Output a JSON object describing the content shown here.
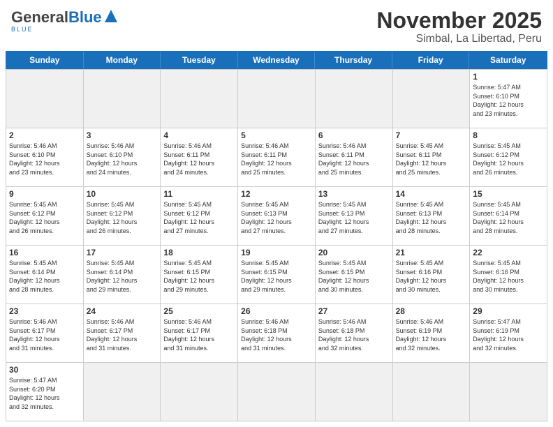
{
  "header": {
    "logo_general": "General",
    "logo_blue": "Blue",
    "month_title": "November 2025",
    "location": "Simbal, La Libertad, Peru"
  },
  "days": {
    "headers": [
      "Sunday",
      "Monday",
      "Tuesday",
      "Wednesday",
      "Thursday",
      "Friday",
      "Saturday"
    ]
  },
  "cells": [
    {
      "number": "",
      "info": "",
      "empty": true
    },
    {
      "number": "",
      "info": "",
      "empty": true
    },
    {
      "number": "",
      "info": "",
      "empty": true
    },
    {
      "number": "",
      "info": "",
      "empty": true
    },
    {
      "number": "",
      "info": "",
      "empty": true
    },
    {
      "number": "",
      "info": "",
      "empty": true
    },
    {
      "number": "1",
      "info": "Sunrise: 5:47 AM\nSunset: 6:10 PM\nDaylight: 12 hours\nand 23 minutes."
    },
    {
      "number": "2",
      "info": "Sunrise: 5:46 AM\nSunset: 6:10 PM\nDaylight: 12 hours\nand 23 minutes."
    },
    {
      "number": "3",
      "info": "Sunrise: 5:46 AM\nSunset: 6:10 PM\nDaylight: 12 hours\nand 24 minutes."
    },
    {
      "number": "4",
      "info": "Sunrise: 5:46 AM\nSunset: 6:11 PM\nDaylight: 12 hours\nand 24 minutes."
    },
    {
      "number": "5",
      "info": "Sunrise: 5:46 AM\nSunset: 6:11 PM\nDaylight: 12 hours\nand 25 minutes."
    },
    {
      "number": "6",
      "info": "Sunrise: 5:46 AM\nSunset: 6:11 PM\nDaylight: 12 hours\nand 25 minutes."
    },
    {
      "number": "7",
      "info": "Sunrise: 5:45 AM\nSunset: 6:11 PM\nDaylight: 12 hours\nand 25 minutes."
    },
    {
      "number": "8",
      "info": "Sunrise: 5:45 AM\nSunset: 6:12 PM\nDaylight: 12 hours\nand 26 minutes."
    },
    {
      "number": "9",
      "info": "Sunrise: 5:45 AM\nSunset: 6:12 PM\nDaylight: 12 hours\nand 26 minutes."
    },
    {
      "number": "10",
      "info": "Sunrise: 5:45 AM\nSunset: 6:12 PM\nDaylight: 12 hours\nand 26 minutes."
    },
    {
      "number": "11",
      "info": "Sunrise: 5:45 AM\nSunset: 6:12 PM\nDaylight: 12 hours\nand 27 minutes."
    },
    {
      "number": "12",
      "info": "Sunrise: 5:45 AM\nSunset: 6:13 PM\nDaylight: 12 hours\nand 27 minutes."
    },
    {
      "number": "13",
      "info": "Sunrise: 5:45 AM\nSunset: 6:13 PM\nDaylight: 12 hours\nand 27 minutes."
    },
    {
      "number": "14",
      "info": "Sunrise: 5:45 AM\nSunset: 6:13 PM\nDaylight: 12 hours\nand 28 minutes."
    },
    {
      "number": "15",
      "info": "Sunrise: 5:45 AM\nSunset: 6:14 PM\nDaylight: 12 hours\nand 28 minutes."
    },
    {
      "number": "16",
      "info": "Sunrise: 5:45 AM\nSunset: 6:14 PM\nDaylight: 12 hours\nand 28 minutes."
    },
    {
      "number": "17",
      "info": "Sunrise: 5:45 AM\nSunset: 6:14 PM\nDaylight: 12 hours\nand 29 minutes."
    },
    {
      "number": "18",
      "info": "Sunrise: 5:45 AM\nSunset: 6:15 PM\nDaylight: 12 hours\nand 29 minutes."
    },
    {
      "number": "19",
      "info": "Sunrise: 5:45 AM\nSunset: 6:15 PM\nDaylight: 12 hours\nand 29 minutes."
    },
    {
      "number": "20",
      "info": "Sunrise: 5:45 AM\nSunset: 6:15 PM\nDaylight: 12 hours\nand 30 minutes."
    },
    {
      "number": "21",
      "info": "Sunrise: 5:45 AM\nSunset: 6:16 PM\nDaylight: 12 hours\nand 30 minutes."
    },
    {
      "number": "22",
      "info": "Sunrise: 5:45 AM\nSunset: 6:16 PM\nDaylight: 12 hours\nand 30 minutes."
    },
    {
      "number": "23",
      "info": "Sunrise: 5:46 AM\nSunset: 6:17 PM\nDaylight: 12 hours\nand 31 minutes."
    },
    {
      "number": "24",
      "info": "Sunrise: 5:46 AM\nSunset: 6:17 PM\nDaylight: 12 hours\nand 31 minutes."
    },
    {
      "number": "25",
      "info": "Sunrise: 5:46 AM\nSunset: 6:17 PM\nDaylight: 12 hours\nand 31 minutes."
    },
    {
      "number": "26",
      "info": "Sunrise: 5:46 AM\nSunset: 6:18 PM\nDaylight: 12 hours\nand 31 minutes."
    },
    {
      "number": "27",
      "info": "Sunrise: 5:46 AM\nSunset: 6:18 PM\nDaylight: 12 hours\nand 32 minutes."
    },
    {
      "number": "28",
      "info": "Sunrise: 5:46 AM\nSunset: 6:19 PM\nDaylight: 12 hours\nand 32 minutes."
    },
    {
      "number": "29",
      "info": "Sunrise: 5:47 AM\nSunset: 6:19 PM\nDaylight: 12 hours\nand 32 minutes."
    },
    {
      "number": "30",
      "info": "Sunrise: 5:47 AM\nSunset: 6:20 PM\nDaylight: 12 hours\nand 32 minutes."
    },
    {
      "number": "",
      "info": "",
      "empty": true
    },
    {
      "number": "",
      "info": "",
      "empty": true
    },
    {
      "number": "",
      "info": "",
      "empty": true
    },
    {
      "number": "",
      "info": "",
      "empty": true
    },
    {
      "number": "",
      "info": "",
      "empty": true
    },
    {
      "number": "",
      "info": "",
      "empty": true
    }
  ]
}
